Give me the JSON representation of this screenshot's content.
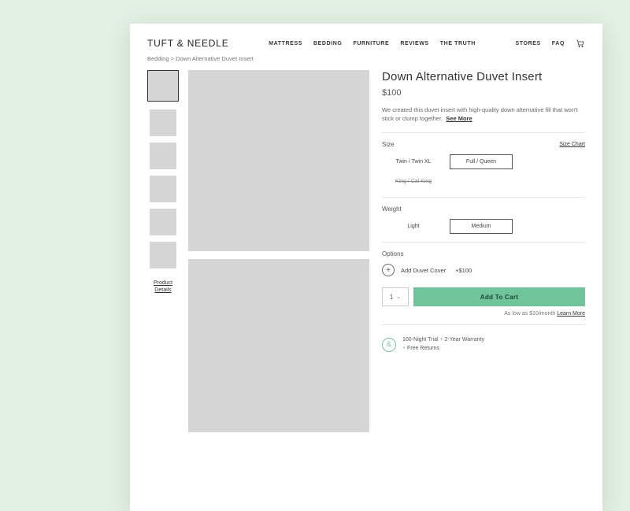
{
  "header": {
    "logo": "TUFT & NEEDLE",
    "nav": [
      "MATTRESS",
      "BEDDING",
      "FURNITURE",
      "REVIEWS",
      "THE TRUTH"
    ],
    "nav_right": [
      "STORES",
      "FAQ"
    ]
  },
  "breadcrumb": "Bedding > Down Alternative Duvet Insert",
  "thumbs": {
    "product_details": "Product\nDetails"
  },
  "product": {
    "title": "Down Alternative Duvet Insert",
    "price": "$100",
    "desc": "We created this duvet insert with high-quality down alternative fill that won't stick or clump together.",
    "see_more": "See More"
  },
  "size": {
    "label": "Size",
    "chart": "Size Chart",
    "options": [
      "Twin / Twin XL",
      "Full / Queen",
      "King / Cal King"
    ],
    "selected": 1,
    "disabled": 2
  },
  "weight": {
    "label": "Weight",
    "options": [
      "Light",
      "Medium"
    ],
    "selected": 1
  },
  "options": {
    "label": "Options",
    "addon_label": "Add Duvet Cover",
    "addon_price": "+$100"
  },
  "cart": {
    "qty": "1",
    "add_label": "Add To Cart",
    "finance_prefix": "As low as $10/month ",
    "finance_link": "Learn More"
  },
  "badges": {
    "b1": "100-Night Trial",
    "b2": "2-Year Warranty",
    "b3": "Free Returns"
  }
}
